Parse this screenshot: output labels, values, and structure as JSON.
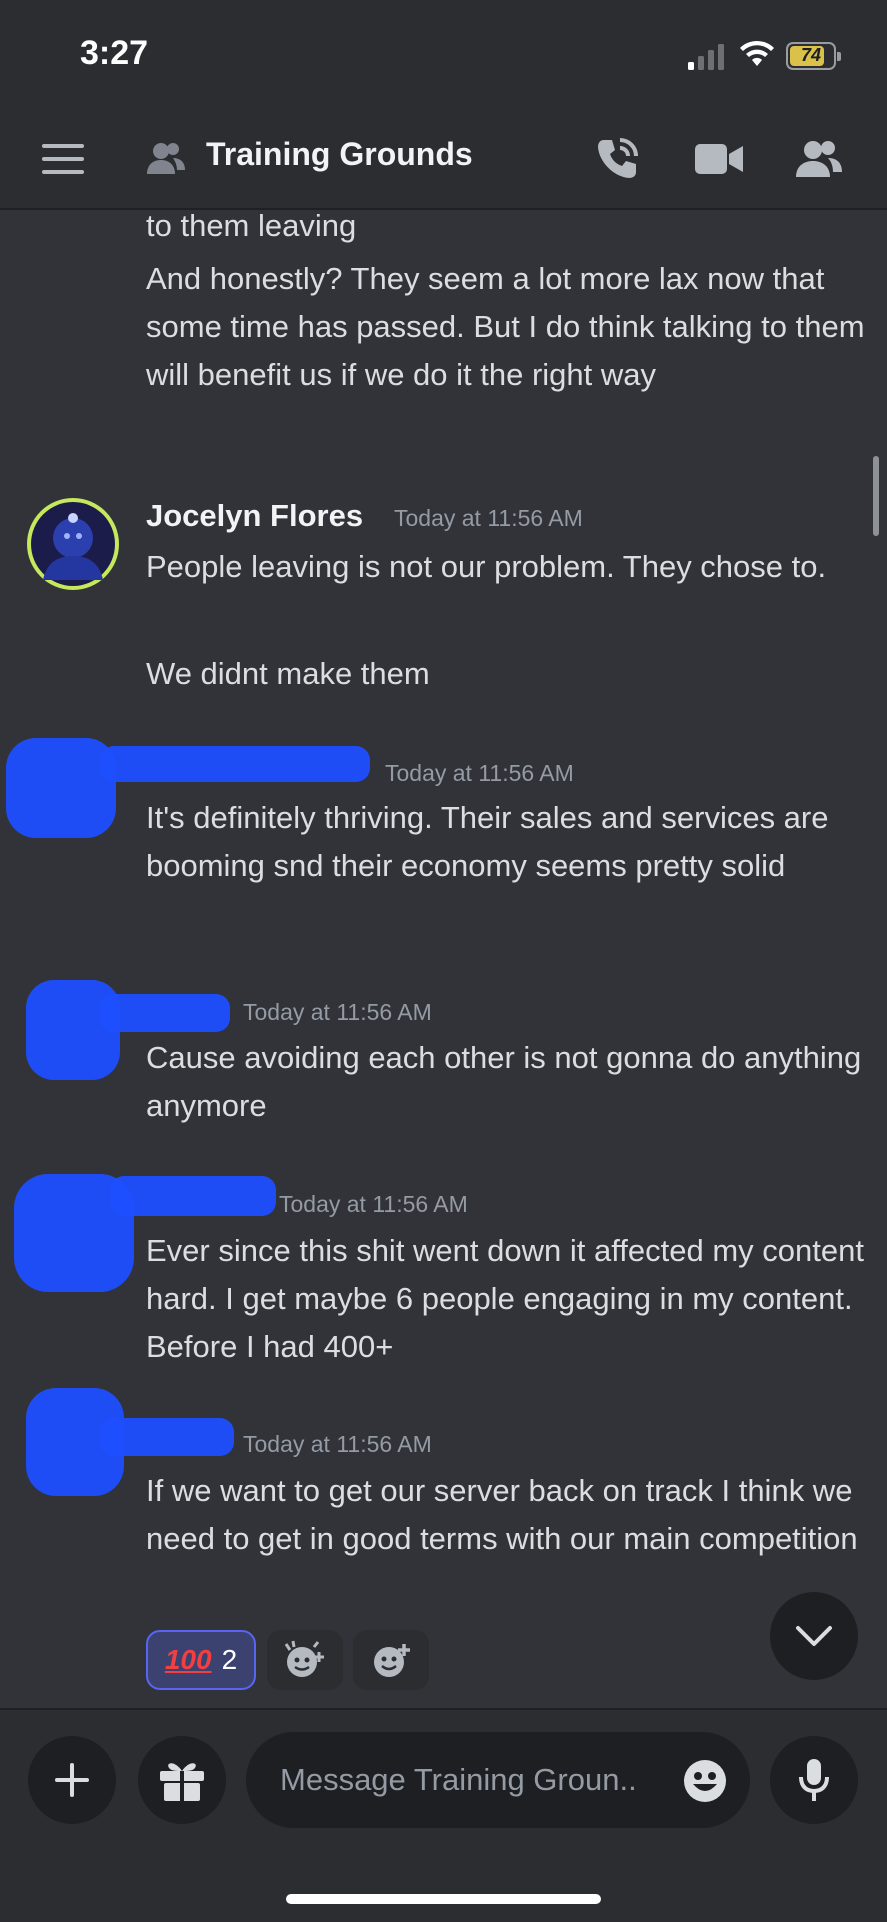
{
  "status_bar": {
    "time": "3:27",
    "battery": "74",
    "battery_level_percent": 74
  },
  "header": {
    "channel_name": "Training Grounds"
  },
  "icons": {
    "menu": "hamburger-menu-icon",
    "channel": "group-dm-icon",
    "voice_call": "phone-call-icon",
    "video_call": "video-camera-icon",
    "members": "members-icon",
    "add": "plus-icon",
    "gift": "gift-icon",
    "emoji": "emoji-icon",
    "mic": "microphone-icon",
    "jump": "chevron-down-icon"
  },
  "messages": {
    "top_fragment": "to them leaving",
    "top_message": "And honestly? They seem a lot more lax now that some time has passed. But I do think talking to them will benefit us if we do it the right way",
    "m1": {
      "author": "Jocelyn Flores",
      "timestamp": "Today at 11:56 AM",
      "line1": "People leaving is not our problem. They chose to.",
      "line2": "We didnt make them"
    },
    "m2": {
      "timestamp": "Today at 11:56 AM",
      "text": "It's definitely thriving. Their sales and services are booming snd their economy seems pretty solid"
    },
    "m3": {
      "timestamp": "Today at 11:56 AM",
      "text": "Cause avoiding each other is not gonna do anything anymore"
    },
    "m4": {
      "timestamp": "Today at 11:56 AM",
      "text": "Ever since this shit went down it affected my content hard. I get maybe 6 people engaging in my content. Before I had 400+"
    },
    "m5": {
      "timestamp": "Today at 11:56 AM",
      "text": "If we want to get our server back on track I think we need to get in good terms with our main competition"
    }
  },
  "reactions": {
    "hundred": {
      "emoji": "💯",
      "count": "2"
    },
    "add_super_reaction": "add-super-reaction-icon",
    "add_reaction": "add-reaction-icon"
  },
  "composer": {
    "placeholder": "Message Training Groun.."
  },
  "colors": {
    "background": "#313338",
    "header": "#2b2d31",
    "accent": "#5865f2",
    "redaction": "#1f4fff"
  }
}
